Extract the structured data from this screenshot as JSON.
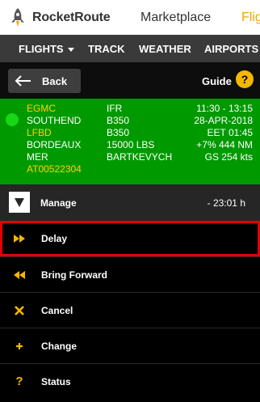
{
  "header": {
    "logo_text": "RocketRoute",
    "marketplace": "Marketplace",
    "flights_cut": "Flig",
    "accent_color": "#f5a400"
  },
  "menu": {
    "items": [
      "FLIGHTS",
      "TRACK",
      "WEATHER",
      "AIRPORTS"
    ]
  },
  "subbar": {
    "back_label": "Back",
    "guide_label": "Guide",
    "guide_icon": "?"
  },
  "flight": {
    "status_color": "#16d816",
    "col1": [
      "EGMC",
      "SOUTHEND",
      "LFBD",
      "BORDEAUX",
      "MER",
      "AT00522304"
    ],
    "col2": [
      "IFR",
      "B350",
      "B350",
      "15000 LBS",
      "BARTKEVYCH"
    ],
    "col3": [
      "11:30 - 13:15",
      "28-APR-2018",
      "EET 01:45",
      "+7% 444 NM",
      "GS 254 kts"
    ]
  },
  "manage": {
    "label": "Manage",
    "time": "- 23:01 h"
  },
  "actions": [
    {
      "label": "Delay",
      "icon": "fast-forward-icon",
      "selected": true
    },
    {
      "label": "Bring Forward",
      "icon": "rewind-icon",
      "selected": false
    },
    {
      "label": "Cancel",
      "icon": "close-icon",
      "selected": false
    },
    {
      "label": "Change",
      "icon": "plus-icon",
      "selected": false
    },
    {
      "label": "Status",
      "icon": "question-icon",
      "selected": false
    }
  ]
}
